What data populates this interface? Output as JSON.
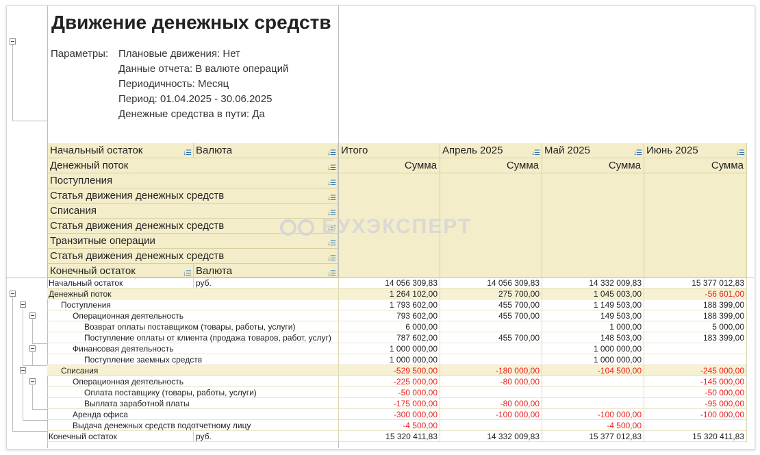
{
  "report": {
    "title": "Движение денежных средств",
    "params_label": "Параметры:",
    "params": [
      "Плановые движения: Нет",
      "Данные отчета: В валюте операций",
      "Периодичность: Месяц",
      "Период: 01.04.2025 - 30.06.2025",
      "Денежные средства в пути: Да"
    ]
  },
  "header": {
    "left_rows": [
      "Начальный остаток",
      "Денежный поток",
      "Поступления",
      "Статья движения денежных средств",
      "Списания",
      "Статья движения денежных средств",
      "Транзитные операции",
      "Статья движения денежных средств",
      "Конечный остаток"
    ],
    "currency_label": "Валюта",
    "columns": [
      "Итого",
      "Апрель 2025",
      "Май 2025",
      "Июнь 2025"
    ],
    "sum_label": "Сумма"
  },
  "watermark": "БУХЭКСПЕРТ",
  "rows": [
    {
      "label": "Начальный остаток",
      "currency": "руб.",
      "values": [
        "14 056 309,83",
        "14 056 309,83",
        "14 332 009,83",
        "15 377 012,83"
      ]
    },
    {
      "label": "Денежный поток",
      "currency": "",
      "values": [
        "1 264 102,00",
        "275 700,00",
        "1 045 003,00",
        "-56 601,00"
      ]
    },
    {
      "label": "Поступления",
      "currency": "",
      "values": [
        "1 793 602,00",
        "455 700,00",
        "1 149 503,00",
        "188 399,00"
      ]
    },
    {
      "label": "Операционная деятельность",
      "currency": "",
      "values": [
        "793 602,00",
        "455 700,00",
        "149 503,00",
        "188 399,00"
      ]
    },
    {
      "label": "Возврат оплаты поставщиком (товары, работы, услуги)",
      "currency": "",
      "values": [
        "6 000,00",
        "",
        "1 000,00",
        "5 000,00"
      ]
    },
    {
      "label": "Поступление оплаты от клиента (продажа товаров, работ, услуг)",
      "currency": "",
      "values": [
        "787 602,00",
        "455 700,00",
        "148 503,00",
        "183 399,00"
      ]
    },
    {
      "label": "Финансовая деятельность",
      "currency": "",
      "values": [
        "1 000 000,00",
        "",
        "1 000 000,00",
        ""
      ]
    },
    {
      "label": "Поступление заемных средств",
      "currency": "",
      "values": [
        "1 000 000,00",
        "",
        "1 000 000,00",
        ""
      ]
    },
    {
      "label": "Списания",
      "currency": "",
      "values": [
        "-529 500,00",
        "-180 000,00",
        "-104 500,00",
        "-245 000,00"
      ]
    },
    {
      "label": "Операционная деятельность",
      "currency": "",
      "values": [
        "-225 000,00",
        "-80 000,00",
        "",
        "-145 000,00"
      ]
    },
    {
      "label": "Оплата поставщику (товары, работы, услуги)",
      "currency": "",
      "values": [
        "-50 000,00",
        "",
        "",
        "-50 000,00"
      ]
    },
    {
      "label": "Выплата заработной платы",
      "currency": "",
      "values": [
        "-175 000,00",
        "-80 000,00",
        "",
        "-95 000,00"
      ]
    },
    {
      "label": "Аренда офиса",
      "currency": "",
      "values": [
        "-300 000,00",
        "-100 000,00",
        "-100 000,00",
        "-100 000,00"
      ]
    },
    {
      "label": "Выдача денежных средств подотчетному лицу",
      "currency": "",
      "values": [
        "-4 500,00",
        "",
        "-4 500,00",
        ""
      ]
    },
    {
      "label": "Конечный остаток",
      "currency": "руб.",
      "values": [
        "15 320 411,83",
        "14 332 009,83",
        "15 377 012,83",
        "15 320 411,83"
      ]
    }
  ]
}
